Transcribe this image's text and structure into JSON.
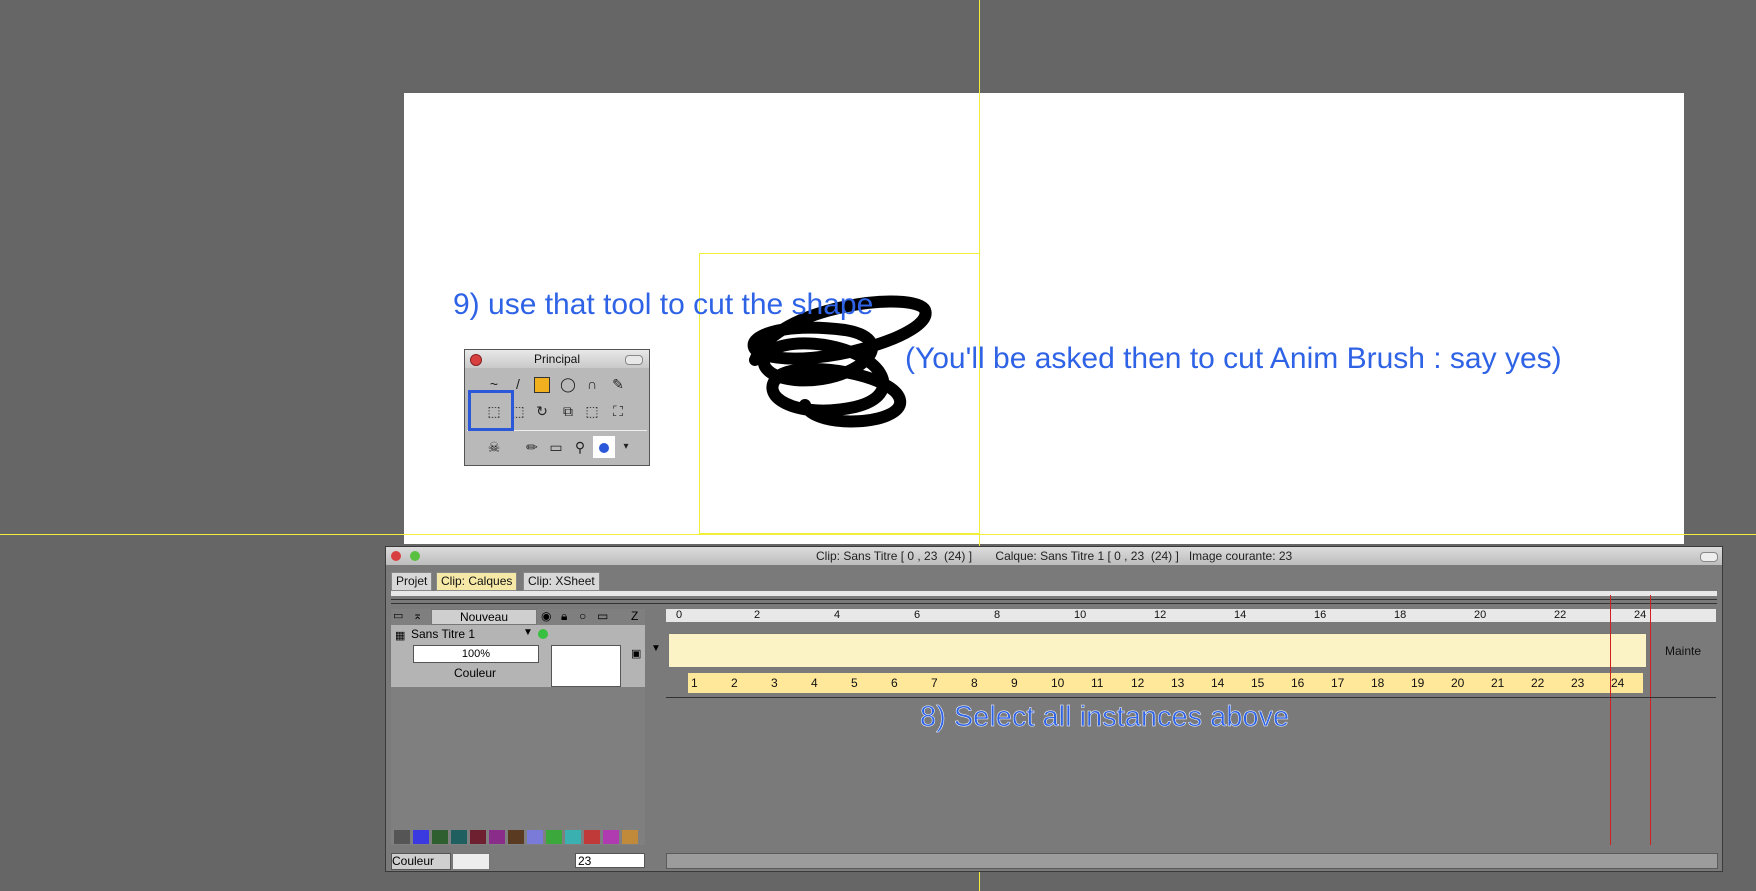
{
  "annotations": {
    "step9": "9) use that tool to cut the shape",
    "step9_note": "(You'll be asked then to cut Anim Brush : say yes)",
    "step8": "8) Select all instances above"
  },
  "palette": {
    "title": "Principal"
  },
  "timeline": {
    "window_title": "Clip: Sans Titre [ 0 , 23  (24) ]       Calque: Sans Titre 1 [ 0 , 23  (24) ]   Image courante: 23",
    "tabs": [
      "Projet",
      "Clip: Calques",
      "Clip: XSheet"
    ],
    "active_tab": "Clip: Calques",
    "new_button": "Nouveau",
    "z_label": "Z",
    "layer_name": "Sans Titre 1",
    "opacity": "100%",
    "blend_mode": "Couleur",
    "bottom_mode": "Couleur",
    "current_frame": "23",
    "right_label": "Mainte",
    "ruler_ticks": [
      "0",
      "2",
      "4",
      "6",
      "8",
      "10",
      "12",
      "14",
      "16",
      "18",
      "20",
      "22",
      "24"
    ],
    "frame_numbers": [
      "1",
      "2",
      "3",
      "4",
      "5",
      "6",
      "7",
      "8",
      "9",
      "10",
      "11",
      "12",
      "13",
      "14",
      "15",
      "16",
      "17",
      "18",
      "19",
      "20",
      "21",
      "22",
      "23",
      "24"
    ]
  },
  "colors": {
    "annotation": "#2f63e6",
    "guide": "#f0ef3a",
    "active_tab": "#f6e9a7",
    "frame_strip": "#ffe89a",
    "swatches": [
      "#555555",
      "#3a3ae0",
      "#2f5f2f",
      "#1f5f5f",
      "#6f2030",
      "#8a2c8a",
      "#5a3a20",
      "#7a7ad8",
      "#3aa83a",
      "#3ab0b0",
      "#c03a3a",
      "#b03ab0",
      "#c08a3a"
    ]
  }
}
